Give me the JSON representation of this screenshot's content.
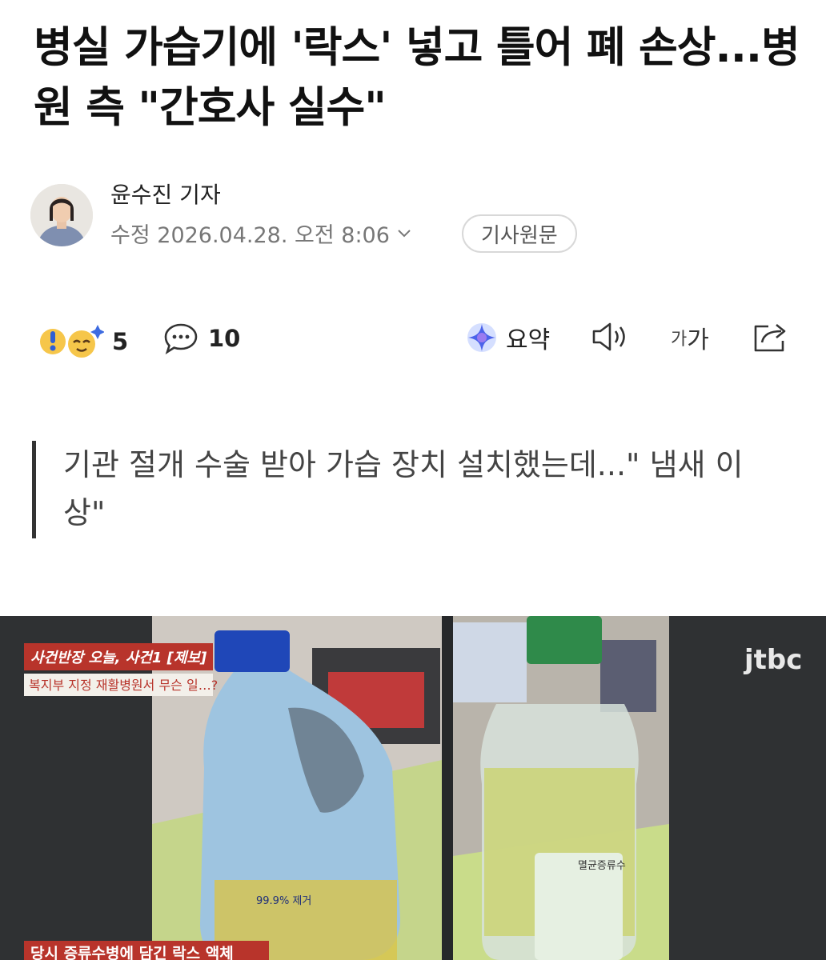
{
  "article": {
    "headline": "병실 가습기에 '락스' 넣고 틀어 폐 손상...병원 측 \"간호사 실수\"",
    "reporter": "윤수진 기자",
    "date_label": "수정 2026.04.28. 오전 8:06",
    "original_button": "기사원문",
    "subtitle": "기관 절개 수술 받아 가습 장치 설치했는데...\" 냄새 이상\""
  },
  "reactions": {
    "count": "5",
    "comments": "10"
  },
  "toolbar": {
    "summary_label": "요약",
    "font_small": "가",
    "font_large": "가"
  },
  "photo": {
    "channel_logo": "jtbc",
    "caption_tag": "사건반장 오늘, 사건1 [제보]",
    "caption_sub": "복지부 지정 재활병원서 무슨 일…?",
    "bottom_caption": "당시 증류수병에 담긴 락스 액체",
    "bottle_label": "멸균증류수",
    "bleach_label": "99.9% 제거"
  },
  "colors": {
    "accent_red": "#b8342b",
    "bottle_blue": "#1f47b8",
    "cap_green": "#2f8a4a"
  },
  "icons": [
    "surprise-emoji-icon",
    "sparkle-emoji-icon",
    "comment-icon",
    "ai-summary-icon",
    "speaker-icon",
    "share-icon",
    "chevron-down-icon"
  ]
}
